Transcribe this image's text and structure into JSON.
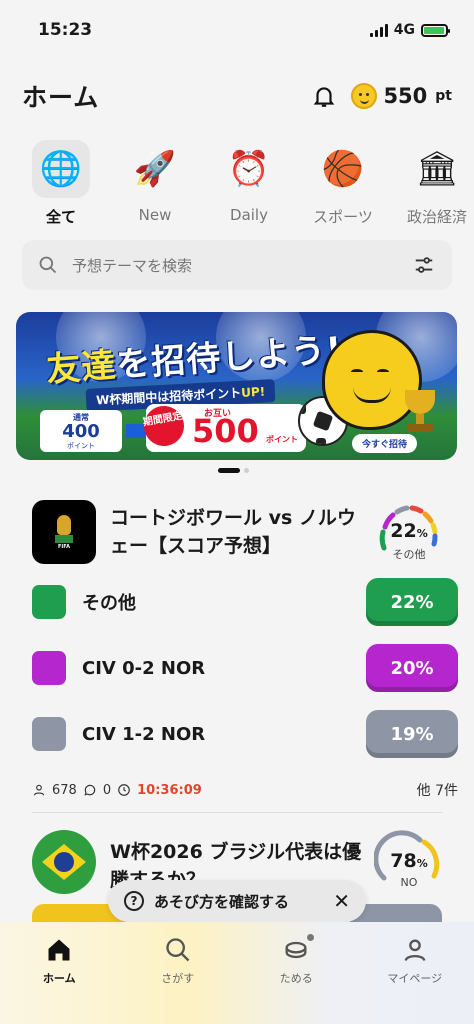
{
  "status": {
    "time": "15:23",
    "network": "4G"
  },
  "header": {
    "title": "ホーム",
    "points_value": "550",
    "points_unit": "pt"
  },
  "categories": [
    {
      "label": "全て",
      "icon": "globe-icon",
      "glyph": "🌐"
    },
    {
      "label": "New",
      "icon": "rocket-icon",
      "glyph": "🚀"
    },
    {
      "label": "Daily",
      "icon": "calendar-clock-icon",
      "glyph": "⏰"
    },
    {
      "label": "スポーツ",
      "icon": "basketball-icon",
      "glyph": "🏀"
    },
    {
      "label": "政治経済",
      "icon": "building-icon",
      "glyph": "🏛"
    }
  ],
  "search": {
    "placeholder": "予想テーマを検索"
  },
  "banner": {
    "title_part1": "友達",
    "title_part2": "を招待しよう!",
    "subtitle_prefix": "W杯期間中は招待ポイント",
    "subtitle_highlight": "UP!",
    "old_label": "通常",
    "old_value": "400",
    "old_unit": "ポイント",
    "limited": "期間限定",
    "each_label": "お互い",
    "new_value": "500",
    "new_unit": "ポイント",
    "cta": "今すぐ招待"
  },
  "question1": {
    "title": "コートジボワール vs ノルウェー【スコア予想】",
    "gauge_value": "22",
    "gauge_unit": "%",
    "gauge_label": "その他",
    "options": [
      {
        "label": "その他",
        "percent": "22%",
        "color": "#1f9e4f"
      },
      {
        "label": "CIV 0-2 NOR",
        "percent": "20%",
        "color": "#b526cf"
      },
      {
        "label": "CIV 1-2 NOR",
        "percent": "19%",
        "color": "#8e96a6"
      }
    ],
    "participants": "678",
    "comments": "0",
    "time_left": "10:36:09",
    "more": "他 7件"
  },
  "question2": {
    "title": "W杯2026 ブラジル代表は優勝するか？",
    "gauge_value": "78",
    "gauge_unit": "%",
    "gauge_label": "NO"
  },
  "toast": {
    "text": "あそび方を確認する"
  },
  "tabs": [
    {
      "label": "ホーム",
      "icon": "home-icon"
    },
    {
      "label": "さがす",
      "icon": "search-icon"
    },
    {
      "label": "ためる",
      "icon": "coin-stack-icon"
    },
    {
      "label": "マイページ",
      "icon": "user-icon"
    }
  ],
  "colors": {
    "accent_green": "#1f9e4f",
    "accent_purple": "#b526cf",
    "accent_gray": "#8e96a6",
    "timer_red": "#e2452c",
    "brand_yellow": "#f6cd1c"
  }
}
